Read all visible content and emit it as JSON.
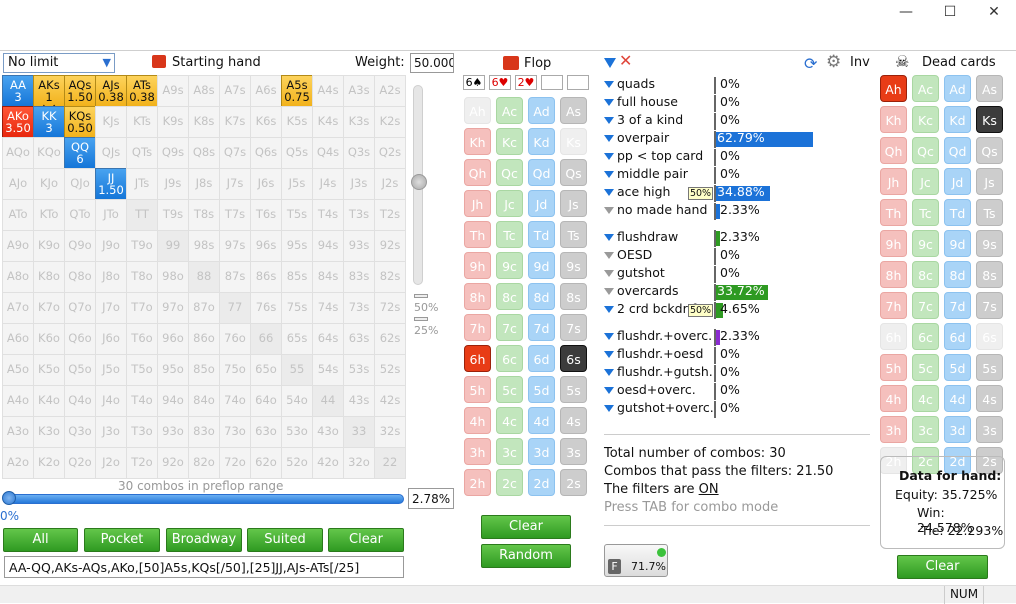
{
  "window": {
    "minimize_label": "—",
    "maximize_label": "☐",
    "close_label": "✕"
  },
  "toolbar": {
    "mode": "No limit",
    "starting_hand_title": "Starting hand",
    "weight_label": "Weight:",
    "weight_value": "50.000"
  },
  "grid": {
    "ranks": [
      "A",
      "K",
      "Q",
      "J",
      "T",
      "9",
      "8",
      "7",
      "6",
      "5",
      "4",
      "3",
      "2"
    ],
    "selected": {
      "AA": {
        "w": "3",
        "c": "blue"
      },
      "AKs": {
        "w": "1",
        "c": "half",
        "suit": "♠♦"
      },
      "AQs": {
        "w": "1.50",
        "c": "half"
      },
      "AJs": {
        "w": "0.38",
        "c": "half"
      },
      "ATs": {
        "w": "0.38",
        "c": "half"
      },
      "A5s": {
        "w": "0.75",
        "c": "half"
      },
      "AKo": {
        "w": "3.50",
        "c": "red"
      },
      "KK": {
        "w": "3",
        "c": "blue"
      },
      "KQs": {
        "w": "0.50",
        "c": "half"
      },
      "QQ": {
        "w": "6",
        "c": "blue"
      },
      "JJ": {
        "w": "1.50",
        "c": "blue"
      }
    }
  },
  "slider": {
    "label_50": "50%",
    "label_25": "25%",
    "range_text": "30 combos in preflop range",
    "range_pct": "2.78%",
    "zero": "0%",
    "fill": 0.0278
  },
  "range_buttons": [
    "All",
    "Pocket",
    "Broadway",
    "Suited",
    "Clear"
  ],
  "range_string": "AA-QQ,AKs-AQs,AKo,[50]A5s,KQs[/50],[25]JJ,AJs-ATs[/25]",
  "flop": {
    "title": "Flop",
    "board": [
      "6♠",
      "6♥",
      "2♥",
      "",
      ""
    ],
    "clear_label": "Clear",
    "random_label": "Random"
  },
  "flop_cards": [
    [
      "Ah",
      "Ac",
      "Ad",
      "As"
    ],
    [
      "Kh",
      "Kc",
      "Kd",
      "Ks"
    ],
    [
      "Qh",
      "Qc",
      "Qd",
      "Qs"
    ],
    [
      "Jh",
      "Jc",
      "Jd",
      "Js"
    ],
    [
      "Th",
      "Tc",
      "Td",
      "Ts"
    ],
    [
      "9h",
      "9c",
      "9d",
      "9s"
    ],
    [
      "8h",
      "8c",
      "8d",
      "8s"
    ],
    [
      "7h",
      "7c",
      "7d",
      "7s"
    ],
    [
      "6h",
      "6c",
      "6d",
      "6s"
    ],
    [
      "5h",
      "5c",
      "5d",
      "5s"
    ],
    [
      "4h",
      "4c",
      "4d",
      "4s"
    ],
    [
      "3h",
      "3c",
      "3d",
      "3s"
    ],
    [
      "2h",
      "2c",
      "2d",
      "2s"
    ]
  ],
  "stats": {
    "group1": [
      {
        "label": "quads",
        "pct": "0%",
        "funnel": "blue",
        "bar": 0
      },
      {
        "label": "full house",
        "pct": "0%",
        "funnel": "blue",
        "bar": 0
      },
      {
        "label": "3 of a kind",
        "pct": "0%",
        "funnel": "blue",
        "bar": 0
      },
      {
        "label": "overpair",
        "pct": "62.79%",
        "funnel": "blue",
        "bar": 0.6279,
        "color": "#1b72d8"
      },
      {
        "label": "pp < top card",
        "pct": "0%",
        "funnel": "blue",
        "bar": 0
      },
      {
        "label": "middle pair",
        "pct": "0%",
        "funnel": "blue",
        "bar": 0
      },
      {
        "label": "ace high",
        "pct": "34.88%",
        "funnel": "blue",
        "bar": 0.3488,
        "color": "#1b72d8",
        "note": "50%"
      },
      {
        "label": "no made hand",
        "pct": "2.33%",
        "funnel": "gray",
        "bar": 0.0233,
        "color": "#1b72d8"
      }
    ],
    "group2": [
      {
        "label": "flushdraw",
        "pct": "2.33%",
        "funnel": "blue",
        "bar": 0.0233,
        "color": "#2e9a22"
      },
      {
        "label": "OESD",
        "pct": "0%",
        "funnel": "gray",
        "bar": 0
      },
      {
        "label": "gutshot",
        "pct": "0%",
        "funnel": "gray",
        "bar": 0
      },
      {
        "label": "overcards",
        "pct": "33.72%",
        "funnel": "gray",
        "bar": 0.3372,
        "color": "#2e9a22"
      },
      {
        "label": "2 crd bckdr f",
        "pct": "4.65%",
        "funnel": "blue",
        "bar": 0.0465,
        "color": "#2e9a22",
        "note": "50%"
      }
    ],
    "group3": [
      {
        "label": "flushdr.+overc.",
        "pct": "2.33%",
        "funnel": "blue",
        "bar": 0.0233,
        "color": "#8a2bd0"
      },
      {
        "label": "flushdr.+oesd",
        "pct": "0%",
        "funnel": "blue",
        "bar": 0
      },
      {
        "label": "flushdr.+gutsh.",
        "pct": "0%",
        "funnel": "blue",
        "bar": 0
      },
      {
        "label": "oesd+overc.",
        "pct": "0%",
        "funnel": "blue",
        "bar": 0
      },
      {
        "label": "gutshot+overc.",
        "pct": "0%",
        "funnel": "blue",
        "bar": 0
      }
    ]
  },
  "summary": {
    "total": "Total number of combos: 30",
    "pass": "Combos that pass the filters: 21.50",
    "filters_pre": "The filters are ",
    "filters_state": "ON",
    "hint": "Press TAB for combo mode",
    "filter_pct": "71.7%"
  },
  "inv_label": "Inv",
  "dead": {
    "title": "Dead cards",
    "clear_label": "Clear",
    "hand_title": "Data for hand:",
    "equity": "Equity: 35.725%",
    "win": "Win: 24.578%",
    "tie": "Tie: 22.293%"
  },
  "status": {
    "num": "NUM"
  }
}
